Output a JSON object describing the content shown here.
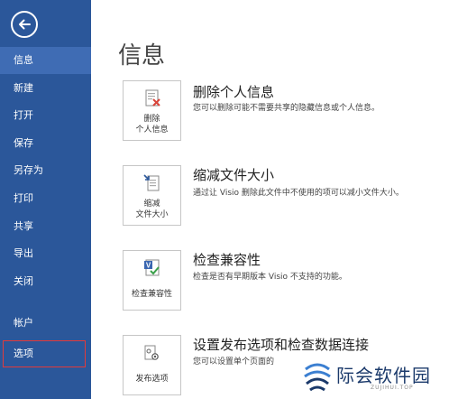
{
  "sidebar": {
    "items": [
      {
        "label": "信息"
      },
      {
        "label": "新建"
      },
      {
        "label": "打开"
      },
      {
        "label": "保存"
      },
      {
        "label": "另存为"
      },
      {
        "label": "打印"
      },
      {
        "label": "共享"
      },
      {
        "label": "导出"
      },
      {
        "label": "关闭"
      },
      {
        "label": "帐户"
      },
      {
        "label": "选项"
      }
    ],
    "active": "信息"
  },
  "main": {
    "title": "信息",
    "sections": [
      {
        "button_lines": [
          "删除",
          "个人信息"
        ],
        "title": "删除个人信息",
        "desc": "您可以删除可能不需要共享的隐藏信息或个人信息。",
        "icon": "remove-info-icon"
      },
      {
        "button_lines": [
          "缩减",
          "文件大小"
        ],
        "title": "缩减文件大小",
        "desc": "通过让 Visio 删除此文件中不使用的项可以减小文件大小。",
        "icon": "reduce-size-icon"
      },
      {
        "button_lines": [
          "检查兼容性"
        ],
        "title": "检查兼容性",
        "desc": "检查是否有早期版本 Visio 不支持的功能。",
        "icon": "check-compat-icon"
      },
      {
        "button_lines": [
          "发布选项"
        ],
        "title": "设置发布选项和检查数据连接",
        "desc": "您可以设置单个页面的",
        "icon": "publish-options-icon"
      }
    ]
  },
  "watermark": {
    "text": "际会软件园",
    "sub": "ZUJIHUI.TOP"
  },
  "colors": {
    "sidebar": "#2b579a",
    "sidebar_active": "#3f6cb4",
    "highlight_box": "#e23b3b"
  }
}
